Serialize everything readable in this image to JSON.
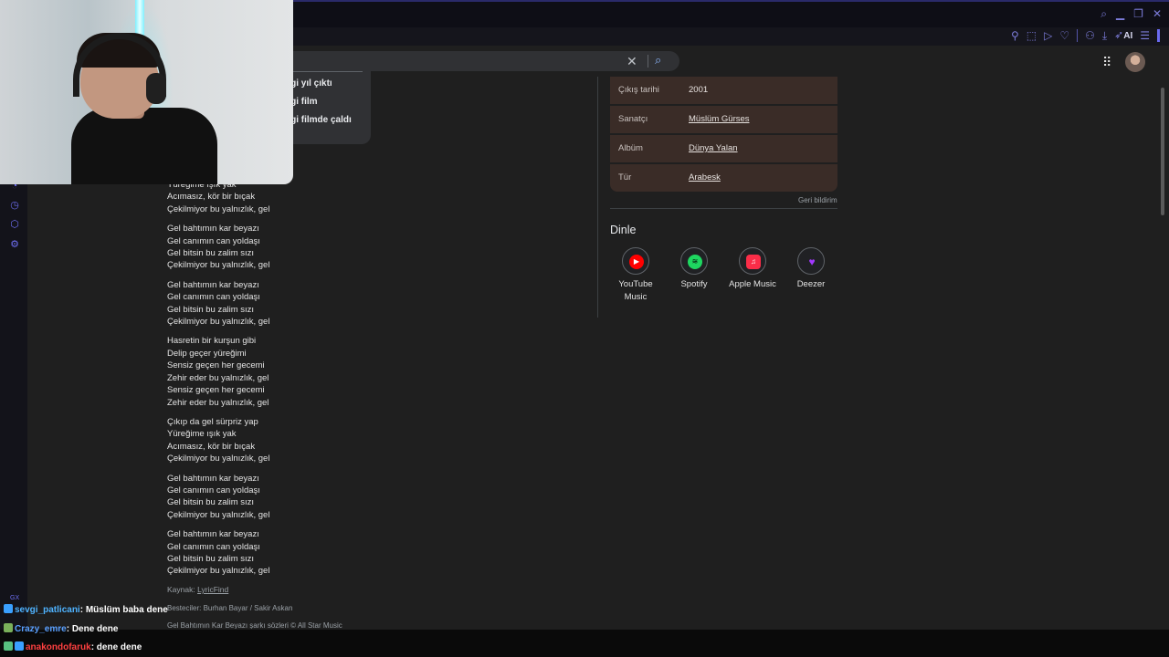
{
  "search": {
    "clear_icon": "close-icon",
    "search_icon": "search-icon"
  },
  "suggestions": [
    "ngi yıl çıktı",
    "ngi film",
    "ngi filmde çaldı"
  ],
  "lyrics": [
    [
      "Yüreğime ışık yak",
      "Acımasız, kör bir bıçak",
      "Çekilmiyor bu yalnızlık, gel"
    ],
    [
      "Gel bahtımın kar beyazı",
      "Gel canımın can yoldaşı",
      "Gel bitsin bu zalim sızı",
      "Çekilmiyor bu yalnızlık, gel"
    ],
    [
      "Gel bahtımın kar beyazı",
      "Gel canımın can yoldaşı",
      "Gel bitsin bu zalim sızı",
      "Çekilmiyor bu yalnızlık, gel"
    ],
    [
      "Hasretin bir kurşun gibi",
      "Delip geçer yüreğimi",
      "Sensiz geçen her gecemi",
      "Zehir eder bu yalnızlık, gel",
      "Sensiz geçen her gecemi",
      "Zehir eder bu yalnızlık, gel"
    ],
    [
      "Çıkıp da gel sürpriz yap",
      "Yüreğime ışık yak",
      "Acımasız, kör bir bıçak",
      "Çekilmiyor bu yalnızlık, gel"
    ],
    [
      "Gel bahtımın kar beyazı",
      "Gel canımın can yoldaşı",
      "Gel bitsin bu zalim sızı",
      "Çekilmiyor bu yalnızlık, gel"
    ],
    [
      "Gel bahtımın kar beyazı",
      "Gel canımın can yoldaşı",
      "Gel bitsin bu zalim sızı",
      "Çekilmiyor bu yalnızlık, gel"
    ]
  ],
  "source": {
    "label": "Kaynak:",
    "link": "LyricFind"
  },
  "composers": "Besteciler: Burhan Bayar / Sakir Askan",
  "copyright": "Gel Bahtımın Kar Beyazı şarkı sözleri © All Star Music",
  "info": [
    {
      "label": "Çıkış tarihi",
      "value": "2001",
      "link": false
    },
    {
      "label": "Sanatçı",
      "value": "Müslüm Gürses",
      "link": true
    },
    {
      "label": "Albüm",
      "value": "Dünya Yalan",
      "link": true
    },
    {
      "label": "Tür",
      "value": "Arabesk",
      "link": true
    }
  ],
  "feedback": "Geri bildirim",
  "listen": {
    "title": "Dinle",
    "platforms": [
      {
        "name": "YouTube Music",
        "icon": "youtube-music-icon",
        "color": "#ff0000"
      },
      {
        "name": "Spotify",
        "icon": "spotify-icon",
        "color": "#1ed760"
      },
      {
        "name": "Apple Music",
        "icon": "apple-music-icon",
        "color": "#fa2d48"
      },
      {
        "name": "Deezer",
        "icon": "deezer-icon",
        "color": "#a238ff"
      }
    ]
  },
  "toolbar": {
    "ai_label": "AI"
  },
  "sidebar": {
    "gx_label": "GX"
  },
  "chat": [
    {
      "user": "sevgi_patlicani",
      "message": "Müslüm baba dene",
      "color": "#4fb3ff"
    },
    {
      "user": "Crazy_emre",
      "message": "Dene dene",
      "color": "#5aa0ff"
    },
    {
      "user": "anakondofaruk",
      "message": "dene dene",
      "color": "#ff4040"
    }
  ]
}
